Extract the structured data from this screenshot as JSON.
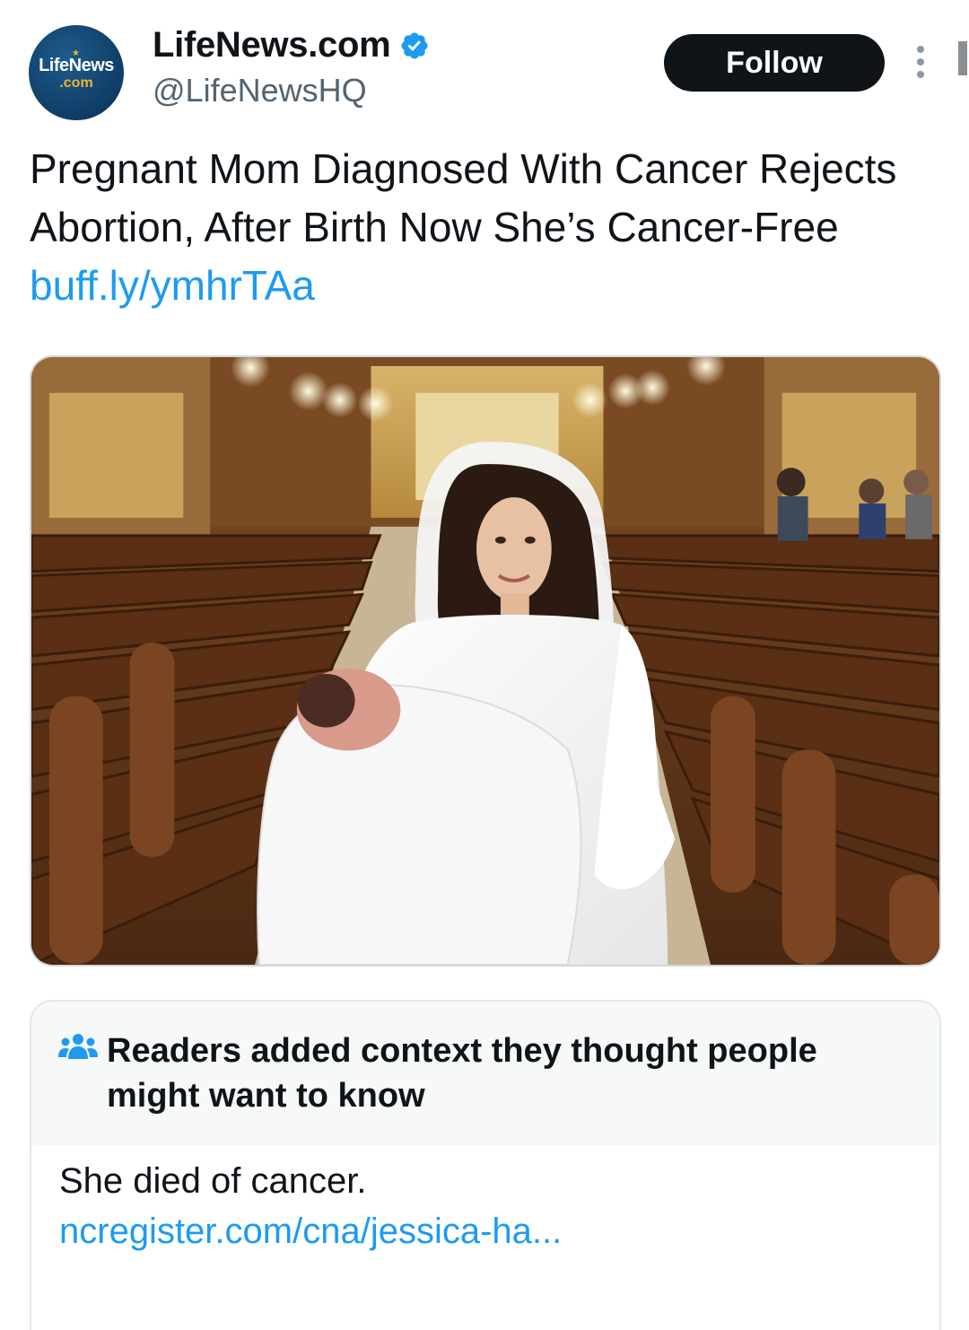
{
  "account": {
    "display_name": "LifeNews.com",
    "handle": "@LifeNewsHQ",
    "verified": true,
    "avatar_logo_text": "LifeNews",
    "avatar_logo_suffix": ".com"
  },
  "header": {
    "follow_label": "Follow",
    "more_icon": "more-vertical-icon"
  },
  "tweet": {
    "text": "Pregnant Mom Diagnosed With Cancer Rejects Abortion, After Birth Now She’s Cancer-Free ",
    "link": "buff.ly/ymhrTAa"
  },
  "note": {
    "icon": "people-icon",
    "title": "Readers added context they thought people might want to know",
    "body": "She died of cancer.",
    "link": "ncregister.com/cna/jessica-ha..."
  },
  "colors": {
    "link": "#1d9bf0",
    "text": "#0f1419",
    "secondary_text": "#536471",
    "follow_bg": "#0f1419",
    "verified": "#1d9bf0",
    "note_header_bg": "#f7f9f9"
  }
}
